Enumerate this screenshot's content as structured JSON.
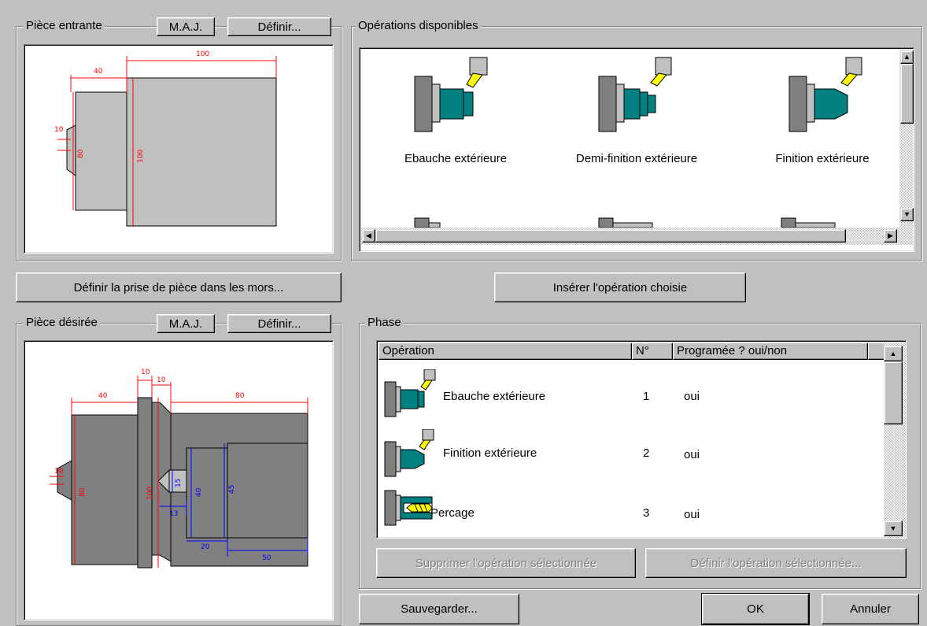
{
  "incoming_part": {
    "title": "Pièce entrante",
    "maj_label": "M.A.J.",
    "define_label": "Définir...",
    "dims": {
      "len1": "40",
      "len2": "100",
      "dia_small": "10",
      "dia1": "80",
      "dia2": "100"
    }
  },
  "available_ops": {
    "title": "Opérations disponibles",
    "items": [
      {
        "label": "Ebauche extérieure",
        "icon": "rough-turning-icon"
      },
      {
        "label": "Demi-finition extérieure",
        "icon": "semi-finish-turning-icon"
      },
      {
        "label": "Finition extérieure",
        "icon": "finish-turning-icon"
      }
    ]
  },
  "chuck_button": "Définir la prise de pièce dans les mors...",
  "insert_button": "Insérer l'opération choisie",
  "desired_part": {
    "title": "Pièce désirée",
    "maj_label": "M.A.J.",
    "define_label": "Définir...",
    "dims": {
      "len1": "40",
      "len2": "10",
      "len3": "10",
      "len4": "80",
      "dia_small": "10",
      "dia1": "80",
      "dia2": "100",
      "bore1": "15",
      "bore2": "40",
      "bore3": "45",
      "d13": "13",
      "d20": "20",
      "d50": "50"
    }
  },
  "phase": {
    "title": "Phase",
    "columns": [
      "Opération",
      "N°",
      "Programée ? oui/non"
    ],
    "rows": [
      {
        "op": "Ebauche extérieure",
        "num": "1",
        "prog": "oui",
        "icon": "rough-turning-icon"
      },
      {
        "op": "Finition extérieure",
        "num": "2",
        "prog": "oui",
        "icon": "finish-turning-icon"
      },
      {
        "op": "Percage",
        "num": "3",
        "prog": "oui",
        "icon": "drilling-icon"
      }
    ],
    "delete_button": "Supprimer l'opération sélectionnée",
    "define_button": "Définir l'opération sélectionnée..."
  },
  "footer": {
    "save": "Sauvegarder...",
    "ok": "OK",
    "cancel": "Annuler"
  },
  "colors": {
    "dialog_bg": "#c0c0c0",
    "part_fill": "#c0c0c0",
    "finished_part_fill": "#808080",
    "workpiece_teal": "#008080",
    "dim_red": "#ff0000",
    "dim_blue": "#0000ff",
    "tool_yellow": "#ffff00"
  }
}
